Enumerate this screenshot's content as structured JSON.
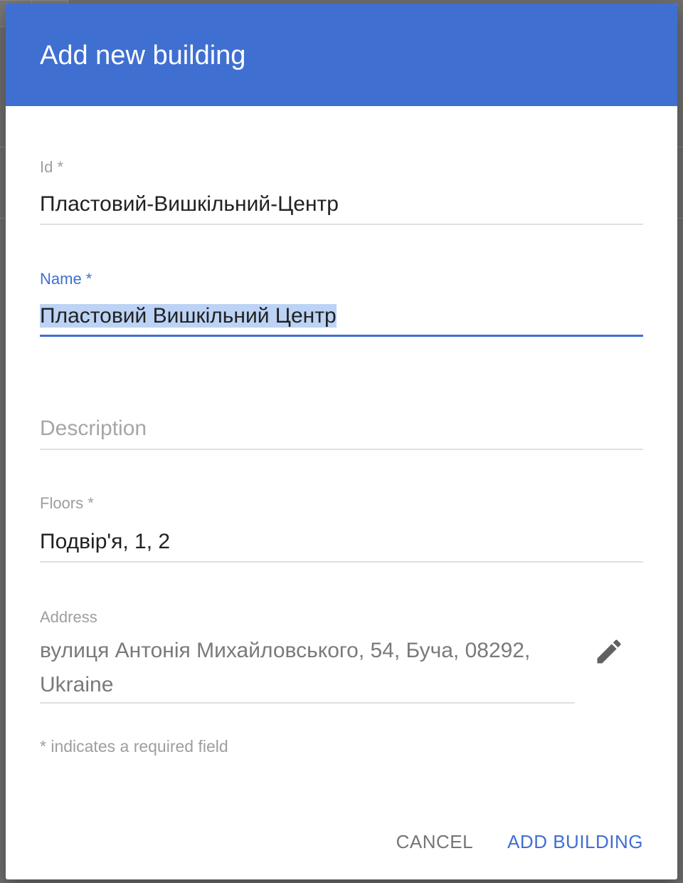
{
  "dialog": {
    "title": "Add new building"
  },
  "fields": {
    "id": {
      "label": "Id *",
      "value": "Пластовий-Вишкільний-Центр"
    },
    "name": {
      "label": "Name *",
      "value": "Пластовий Вишкільний Центр"
    },
    "description": {
      "placeholder": "Description",
      "value": ""
    },
    "floors": {
      "label": "Floors *",
      "value": "Подвір'я, 1, 2"
    },
    "address": {
      "label": "Address",
      "value": "вулиця Антонія Михайловського, 54, Буча, 08292, Ukraine",
      "edit_icon": "pencil-icon"
    }
  },
  "hint": "* indicates a required field",
  "actions": {
    "cancel_label": "CANCEL",
    "add_label": "ADD BUILDING"
  },
  "colors": {
    "accent": "#3f6fd1",
    "selection": "#bcd3f5",
    "muted": "#9e9e9e"
  }
}
